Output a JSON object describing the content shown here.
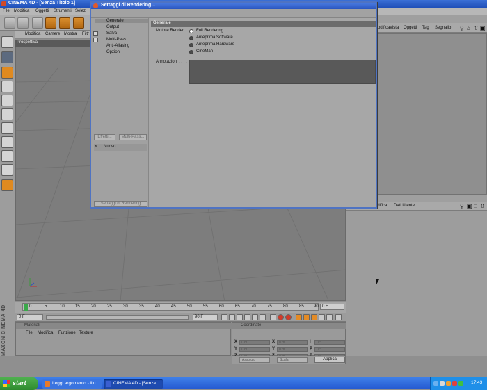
{
  "app": {
    "window_title": "CINEMA 4D - [Senza Titolo 1]",
    "menu": [
      "File",
      "Modifica",
      "Oggetti",
      "Strumenti",
      "Selezi"
    ]
  },
  "viewport": {
    "menu": [
      "Modifica",
      "Camere",
      "Mostra",
      "Filtr"
    ],
    "label": "Prospettiva"
  },
  "timeline": {
    "ticks": [
      "0",
      "5",
      "10",
      "15",
      "20",
      "25",
      "30",
      "35",
      "40",
      "45",
      "50",
      "55",
      "60",
      "65",
      "70",
      "75",
      "80",
      "85",
      "90"
    ],
    "end_field": "0 F",
    "start_field": "0 F",
    "max_field": "90 F"
  },
  "materials": {
    "header": "Materiali",
    "menu": [
      "File",
      "Modifica",
      "Funzione",
      "Texture"
    ]
  },
  "coordinates": {
    "header": "Coordinate",
    "rows": [
      {
        "l1": "X",
        "v1": "0 m",
        "l2": "X",
        "v2": "0 m",
        "l3": "H",
        "v3": "0 °"
      },
      {
        "l1": "Y",
        "v1": "0 m",
        "l2": "Y",
        "v2": "0 m",
        "l3": "P",
        "v3": "0 °"
      },
      {
        "l1": "Z",
        "v1": "0 m",
        "l2": "Z",
        "v2": "0 m",
        "l3": "B",
        "v3": "0 °"
      }
    ],
    "mode_select": "Assoluto",
    "scale_select": "Scala",
    "apply_label": "Applica"
  },
  "object_manager": {
    "menu": [
      "odifica",
      "Vista",
      "Oggetti",
      "Tag",
      "Segnalib"
    ]
  },
  "attribute_manager": {
    "menu": [
      "odifica",
      "Dati Utente"
    ]
  },
  "render_dialog": {
    "title": "Settaggi di Rendering...",
    "nav": [
      "Generale",
      "Output",
      "Salva",
      "Multi-Pass",
      "Anti-Aliasing",
      "Opzioni"
    ],
    "effects_button": "Effetti...",
    "multipass_button": "Multi-Pass...",
    "new_label": "Nuovo",
    "settings_button": "Settaggi di Rendering",
    "section_title": "Generale",
    "engine_label": "Motore Render . .",
    "engines": [
      "Full Rendering",
      "Anteprima Software",
      "Anteprima Hardware",
      "CineMan"
    ],
    "selected_engine_index": 0,
    "annotations_label": "Annotazioni . . . ."
  },
  "branding": "MAXON CINEMA 4D",
  "taskbar": {
    "start": "start",
    "tasks": [
      "Leggi argomento - illu...",
      "CINEMA 4D - [Senza ..."
    ],
    "clock": "17:43"
  }
}
